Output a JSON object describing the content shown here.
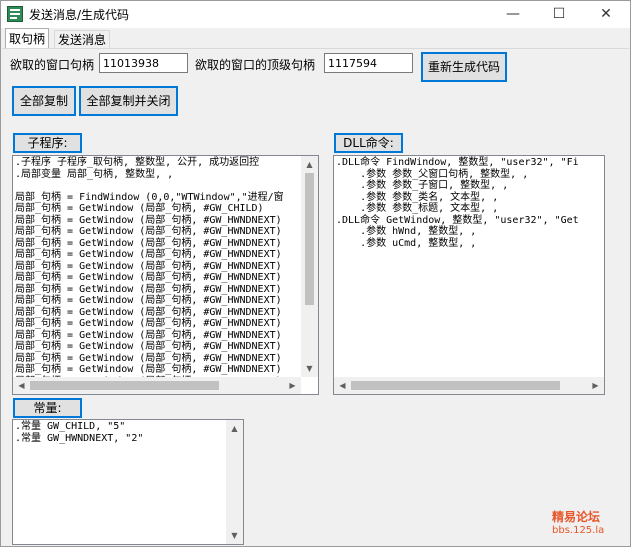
{
  "window": {
    "title": "发送消息/生成代码",
    "minimize": "—",
    "maximize": "☐",
    "close": "✕"
  },
  "tabs": [
    "取句柄",
    "发送消息"
  ],
  "form": {
    "window_handle_label": "欲取的窗口句柄",
    "window_handle_value": "11013938",
    "top_handle_label": "欲取的窗口的顶级句柄",
    "top_handle_value": "1117594",
    "regenerate_button": "重新生成代码",
    "copy_all_button": "全部复制",
    "copy_all_close_button": "全部复制并关闭"
  },
  "subroutine": {
    "label": "子程序:",
    "code": ".子程序 子程序_取句柄, 整数型, 公开, 成功返回控\n.局部变量 局部_句柄, 整数型, ,\n\n局部_句柄 = FindWindow (0,0,\"WTWindow\",\"进程/窗\n局部_句柄 = GetWindow (局部_句柄, #GW_CHILD)\n局部_句柄 = GetWindow (局部_句柄, #GW_HWNDNEXT)\n局部_句柄 = GetWindow (局部_句柄, #GW_HWNDNEXT)\n局部_句柄 = GetWindow (局部_句柄, #GW_HWNDNEXT)\n局部_句柄 = GetWindow (局部_句柄, #GW_HWNDNEXT)\n局部_句柄 = GetWindow (局部_句柄, #GW_HWNDNEXT)\n局部_句柄 = GetWindow (局部_句柄, #GW_HWNDNEXT)\n局部_句柄 = GetWindow (局部_句柄, #GW_HWNDNEXT)\n局部_句柄 = GetWindow (局部_句柄, #GW_HWNDNEXT)\n局部_句柄 = GetWindow (局部_句柄, #GW_HWNDNEXT)\n局部_句柄 = GetWindow (局部_句柄, #GW_HWNDNEXT)\n局部_句柄 = GetWindow (局部_句柄, #GW_HWNDNEXT)\n局部_句柄 = GetWindow (局部_句柄, #GW_HWNDNEXT)\n局部_句柄 = GetWindow (局部_句柄, #GW_HWNDNEXT)\n局部_句柄 = GetWindow (局部_句柄, #GW_HWNDNEXT)\n局部_句柄 = GetWindow (局部_句柄, #GW_HWNDNEXT)\n局部_句柄 = GetWindow (局部_句柄, #GW_HWNDNEXT)"
  },
  "dll": {
    "label": "DLL命令:",
    "code": ".DLL命令 FindWindow, 整数型, \"user32\", \"Fi\n    .参数 参数_父窗口句柄, 整数型, ,\n    .参数 参数_子窗口, 整数型, ,\n    .参数 参数_类名, 文本型, ,\n    .参数 参数_标题, 文本型, ,\n.DLL命令 GetWindow, 整数型, \"user32\", \"Get\n    .参数 hWnd, 整数型, ,\n    .参数 uCmd, 整数型, ,"
  },
  "constants": {
    "label": "常量:",
    "code": ".常量 GW_CHILD, \"5\"\n.常量 GW_HWNDNEXT, \"2\""
  },
  "watermark": {
    "line1": "精易论坛",
    "line2": "bbs.125.la"
  }
}
